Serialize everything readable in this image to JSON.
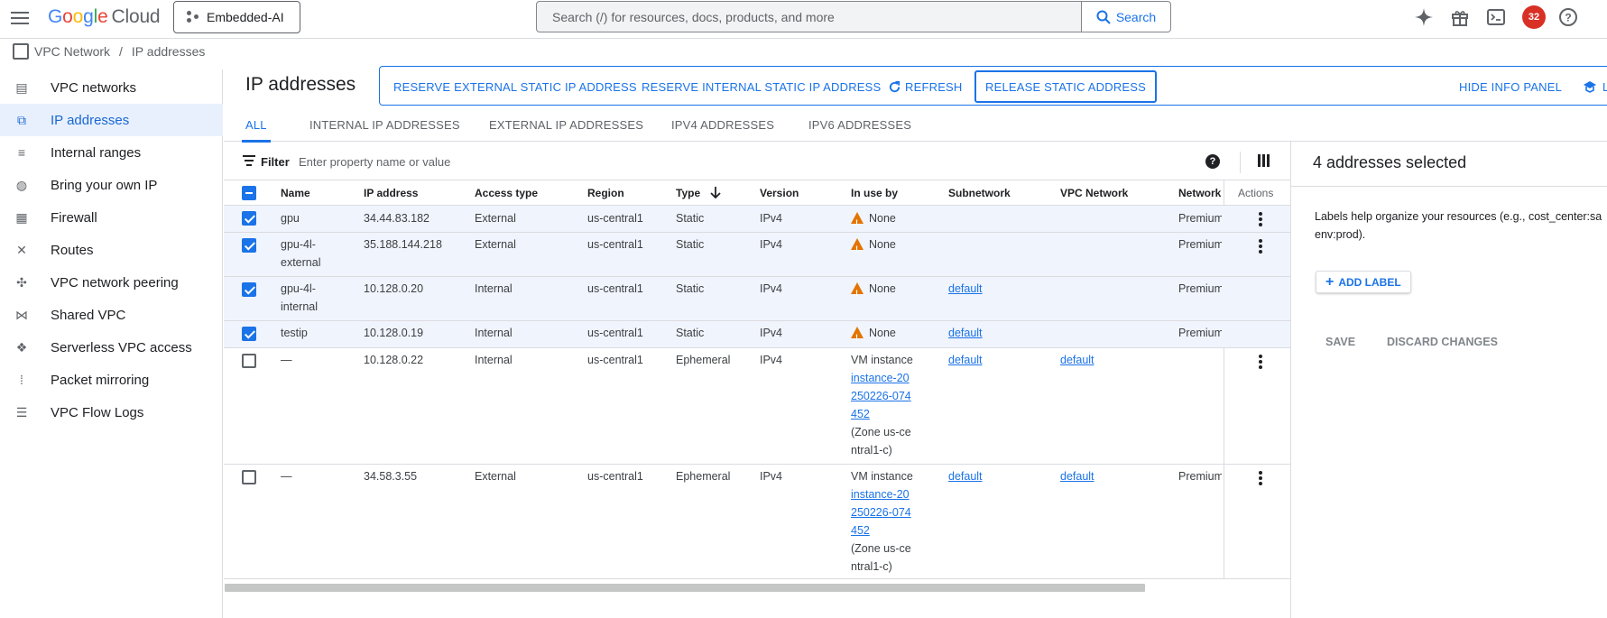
{
  "header": {
    "logo_google": "Google",
    "logo_cloud": "Cloud",
    "project": "Embedded-AI",
    "search_placeholder": "Search (/) for resources, docs, products, and more",
    "search_button": "Search",
    "notification_count": "32",
    "icons": [
      "menu-icon",
      "gemini-spark-icon",
      "gift-icon",
      "cloud-shell-icon",
      "help-icon"
    ]
  },
  "breadcrumb": {
    "product": "VPC Network",
    "separator": "/",
    "page": "IP addresses"
  },
  "sidebar": {
    "items": [
      {
        "label": "VPC networks",
        "icon": "vpc-networks-icon",
        "active": false
      },
      {
        "label": "IP addresses",
        "icon": "ip-addresses-icon",
        "active": true
      },
      {
        "label": "Internal ranges",
        "icon": "internal-ranges-icon",
        "active": false
      },
      {
        "label": "Bring your own IP",
        "icon": "globe-icon",
        "active": false
      },
      {
        "label": "Firewall",
        "icon": "firewall-icon",
        "active": false
      },
      {
        "label": "Routes",
        "icon": "routes-icon",
        "active": false
      },
      {
        "label": "VPC network peering",
        "icon": "peering-icon",
        "active": false
      },
      {
        "label": "Shared VPC",
        "icon": "shared-vpc-icon",
        "active": false
      },
      {
        "label": "Serverless VPC access",
        "icon": "serverless-icon",
        "active": false
      },
      {
        "label": "Packet mirroring",
        "icon": "packet-mirroring-icon",
        "active": false
      },
      {
        "label": "VPC Flow Logs",
        "icon": "flow-logs-icon",
        "active": false
      }
    ]
  },
  "main": {
    "title": "IP addresses",
    "actions": {
      "reserve_external": "RESERVE EXTERNAL STATIC IP ADDRESS",
      "reserve_internal": "RESERVE INTERNAL STATIC IP ADDRESS",
      "refresh": "REFRESH",
      "release": "RELEASE STATIC ADDRESS",
      "hide_info": "HIDE INFO PANEL",
      "learn_partial": "L"
    },
    "tabs": [
      {
        "label": "ALL",
        "active": true
      },
      {
        "label": "INTERNAL IP ADDRESSES",
        "active": false
      },
      {
        "label": "EXTERNAL IP ADDRESSES",
        "active": false
      },
      {
        "label": "IPV4 ADDRESSES",
        "active": false
      },
      {
        "label": "IPV6 ADDRESSES",
        "active": false
      }
    ],
    "filter": {
      "label": "Filter",
      "placeholder": "Enter property name or value"
    },
    "table": {
      "columns": [
        "Name",
        "IP address",
        "Access type",
        "Region",
        "Type",
        "Version",
        "In use by",
        "Subnetwork",
        "VPC Network",
        "Network T",
        "Actions"
      ],
      "sort_column": "Type",
      "rows": [
        {
          "selected": true,
          "name": "gpu",
          "ip": "34.44.83.182",
          "access": "External",
          "region": "us-central1",
          "type": "Static",
          "version": "IPv4",
          "in_use": "None",
          "subnet": "",
          "vpc": "",
          "tier": "Premium",
          "has_menu": true
        },
        {
          "selected": true,
          "name": "gpu-4l-external",
          "ip": "35.188.144.218",
          "access": "External",
          "region": "us-central1",
          "type": "Static",
          "version": "IPv4",
          "in_use": "None",
          "subnet": "",
          "vpc": "",
          "tier": "Premium",
          "has_menu": true
        },
        {
          "selected": true,
          "name": "gpu-4l-internal",
          "ip": "10.128.0.20",
          "access": "Internal",
          "region": "us-central1",
          "type": "Static",
          "version": "IPv4",
          "in_use": "None",
          "subnet": "default",
          "vpc": "",
          "tier": "Premium",
          "has_menu": false
        },
        {
          "selected": true,
          "name": "testip",
          "ip": "10.128.0.19",
          "access": "Internal",
          "region": "us-central1",
          "type": "Static",
          "version": "IPv4",
          "in_use": "None",
          "subnet": "default",
          "vpc": "",
          "tier": "Premium",
          "has_menu": false
        },
        {
          "selected": false,
          "name": "—",
          "ip": "10.128.0.22",
          "access": "Internal",
          "region": "us-central1",
          "type": "Ephemeral",
          "version": "IPv4",
          "in_use_prefix": "VM instance",
          "in_use_link": "instance-20250226-074452",
          "in_use_suffix": "(Zone us-central1-c)",
          "subnet": "default",
          "vpc": "default",
          "tier": "",
          "has_menu": true
        },
        {
          "selected": false,
          "name": "—",
          "ip": "34.58.3.55",
          "access": "External",
          "region": "us-central1",
          "type": "Ephemeral",
          "version": "IPv4",
          "in_use_prefix": "VM instance",
          "in_use_link": "instance-20250226-074452",
          "in_use_suffix": "(Zone us-central1-c)",
          "subnet": "default",
          "vpc": "default",
          "tier": "Premium",
          "has_menu": true
        }
      ]
    }
  },
  "info_panel": {
    "title": "4 addresses selected",
    "labels_help_line1": "Labels help organize your resources (e.g., cost_center:sa",
    "labels_help_line2": "env:prod).",
    "add_label": "ADD LABEL",
    "save": "SAVE",
    "discard": "DISCARD CHANGES"
  },
  "colors": {
    "accent": "#1a73e8",
    "warning": "#e37400",
    "notification": "#d93025",
    "selected_row": "#f0f4fc"
  }
}
